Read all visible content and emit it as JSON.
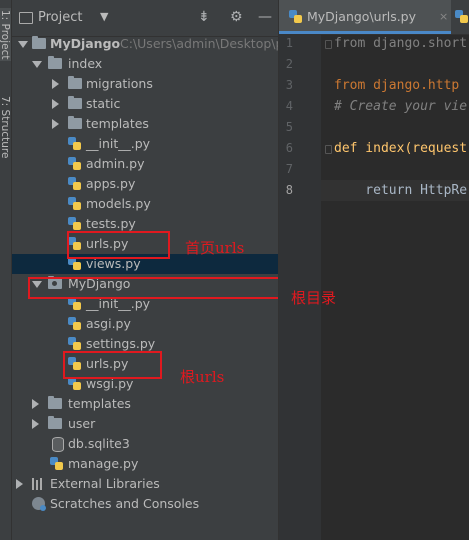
{
  "sidebar_strip": {
    "project_tab": "1: Project",
    "structure_tab": "7: Structure"
  },
  "project_panel": {
    "title": "Project",
    "tree": [
      {
        "label": "MyDjango",
        "path": "C:\\Users\\admin\\Desktop\\p",
        "kind": "folder",
        "expanded": true,
        "bold": true
      },
      {
        "label": "index",
        "kind": "folder",
        "expanded": true
      },
      {
        "label": "migrations",
        "kind": "folder",
        "expanded": false
      },
      {
        "label": "static",
        "kind": "folder",
        "expanded": false
      },
      {
        "label": "templates",
        "kind": "folder",
        "expanded": false
      },
      {
        "label": "__init__.py",
        "kind": "python"
      },
      {
        "label": "admin.py",
        "kind": "python"
      },
      {
        "label": "apps.py",
        "kind": "python"
      },
      {
        "label": "models.py",
        "kind": "python"
      },
      {
        "label": "tests.py",
        "kind": "python"
      },
      {
        "label": "urls.py",
        "kind": "python"
      },
      {
        "label": "views.py",
        "kind": "python",
        "selected": true
      },
      {
        "label": "MyDjango",
        "kind": "package",
        "expanded": true
      },
      {
        "label": "__init__.py",
        "kind": "python"
      },
      {
        "label": "asgi.py",
        "kind": "python"
      },
      {
        "label": "settings.py",
        "kind": "python"
      },
      {
        "label": "urls.py",
        "kind": "python"
      },
      {
        "label": "wsgi.py",
        "kind": "python"
      },
      {
        "label": "templates",
        "kind": "folder",
        "expanded": false
      },
      {
        "label": "user",
        "kind": "folder",
        "expanded": false
      },
      {
        "label": "db.sqlite3",
        "kind": "database"
      },
      {
        "label": "manage.py",
        "kind": "python"
      },
      {
        "label": "External Libraries",
        "kind": "library",
        "expanded": false
      },
      {
        "label": "Scratches and Consoles",
        "kind": "scratch"
      }
    ]
  },
  "annotations": {
    "index_urls": "首页urls",
    "root_dir": "根目录",
    "root_urls": "根urls",
    "color": "#e0191f"
  },
  "editor": {
    "tabs": [
      {
        "label": "MyDjango\\urls.py",
        "close": "×",
        "active": true
      },
      {
        "label": "in"
      }
    ],
    "line_numbers": [
      "1",
      "2",
      "3",
      "4",
      "5",
      "6",
      "7",
      "8"
    ],
    "code": [
      {
        "text": "from django.short",
        "style": "folded"
      },
      {
        "text": ""
      },
      {
        "text": "from django.http",
        "style": "import"
      },
      {
        "text": "# Create your vie",
        "style": "comment"
      },
      {
        "text": ""
      },
      {
        "text": "def index(request",
        "style": "def"
      },
      {
        "text": ""
      },
      {
        "text": "    return HttpRe",
        "style": "return"
      }
    ]
  },
  "colors": {
    "keyword": "#cc7832",
    "comment": "#808080",
    "function": "#ffc66d",
    "text": "#a9b7c6",
    "accent": "#4a88c7"
  }
}
